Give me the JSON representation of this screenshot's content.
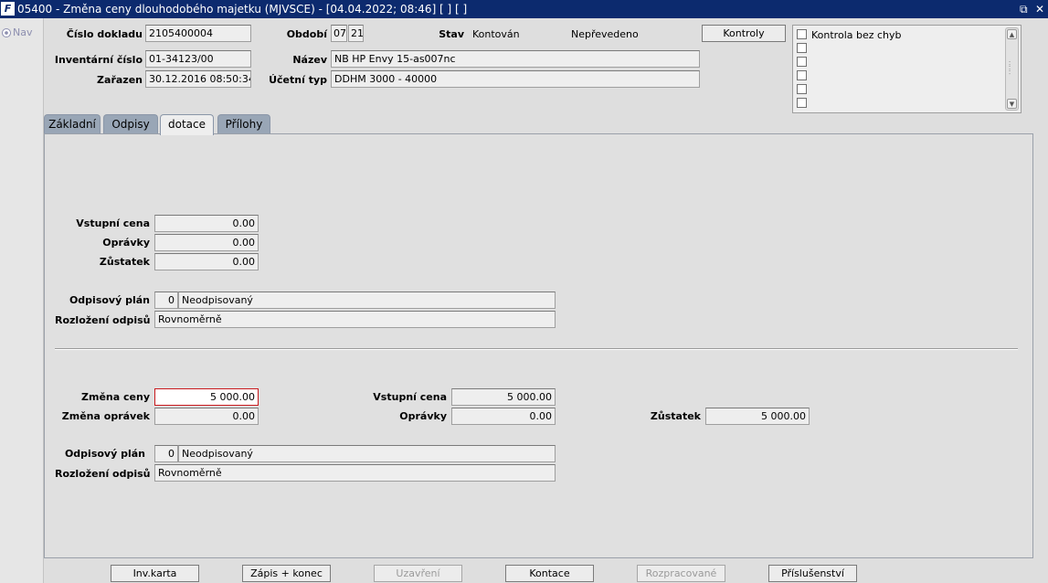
{
  "window": {
    "title": "05400 - Změna ceny dlouhodobého majetku (MJVSCE) - [04.04.2022; 08:46]  [ ] [ ]",
    "logo": "F",
    "controls": {
      "restore": "⧉",
      "close": "✕"
    }
  },
  "leftnav": {
    "item_label": "Nav"
  },
  "header": {
    "cislo_dokladu_label": "Číslo dokladu",
    "cislo_dokladu": "2105400004",
    "obdobi_label": "Období",
    "obdobi_month": "07",
    "obdobi_year": "21",
    "stav_label": "Stav",
    "stav_value1": "Kontován",
    "stav_value2": "Nepřevedeno",
    "kontroly_button": "Kontroly",
    "inv_cislo_label": "Inventární číslo",
    "inv_cislo": "01-34123/00",
    "nazev_label": "Název",
    "nazev": "NB HP Envy 15-as007nc",
    "zarazen_label": "Zařazen",
    "zarazen": "30.12.2016 08:50:34",
    "ucetni_typ_label": "Účetní typ",
    "ucetni_typ": "DDHM 3000 - 40000"
  },
  "checks": {
    "items": [
      {
        "label": "Kontrola bez chyb",
        "checked": false
      },
      {
        "label": "",
        "checked": false
      },
      {
        "label": "",
        "checked": false
      },
      {
        "label": "",
        "checked": false
      },
      {
        "label": "",
        "checked": false
      },
      {
        "label": "",
        "checked": false
      }
    ]
  },
  "tabs": [
    {
      "label": "Základní",
      "active": false
    },
    {
      "label": "Odpisy",
      "active": false
    },
    {
      "label": "dotace",
      "active": true
    },
    {
      "label": "Přílohy",
      "active": false
    }
  ],
  "before": {
    "vstupni_cena_label": "Vstupní cena",
    "vstupni_cena": "0.00",
    "opravky_label": "Oprávky",
    "opravky": "0.00",
    "zustatek_label": "Zůstatek",
    "zustatek": "0.00",
    "odpisovy_plan_label": "Odpisový plán",
    "odpisovy_plan_code": "0",
    "odpisovy_plan_name": "Neodpisovaný",
    "rozlozeni_label": "Rozložení odpisů",
    "rozlozeni": "Rovnoměrně"
  },
  "change": {
    "zmena_ceny_label": "Změna ceny",
    "zmena_ceny": "5 000.00",
    "zmena_opravek_label": "Změna oprávek",
    "zmena_opravek": "0.00",
    "vstupni_cena_label": "Vstupní cena",
    "vstupni_cena": "5 000.00",
    "opravky_label": "Oprávky",
    "opravky": "0.00",
    "zustatek_label": "Zůstatek",
    "zustatek": "5 000.00",
    "odpisovy_plan_label": "Odpisový plán",
    "odpisovy_plan_code": "0",
    "odpisovy_plan_name": "Neodpisovaný",
    "rozlozeni_label": "Rozložení odpisů",
    "rozlozeni": "Rovnoměrně"
  },
  "footer": {
    "inv_karta": "Inv.karta",
    "zapis_konec": "Zápis + konec",
    "uzavreni": "Uzavření",
    "kontace": "Kontace",
    "rozpracovane": "Rozpracované",
    "prislusenstvi": "Příslušenství"
  }
}
